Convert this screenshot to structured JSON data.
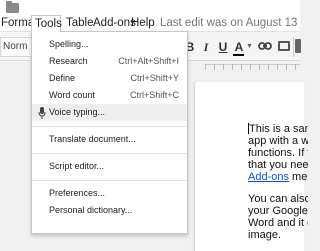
{
  "menubar": {
    "items": [
      "Format",
      "Tools",
      "Table",
      "Add-ons",
      "Help"
    ],
    "last_edit": "Last edit was on August 13"
  },
  "toolbar": {
    "style_value": "Norm",
    "bold_label": "B",
    "italic_label": "I",
    "underline_label": "U",
    "text_color_label": "A"
  },
  "tools_menu": {
    "items": [
      {
        "label": "Spelling...",
        "shortcut": ""
      },
      {
        "label": "Research",
        "shortcut": "Ctrl+Alt+Shift+I"
      },
      {
        "label": "Define",
        "shortcut": "Ctrl+Shift+Y"
      },
      {
        "label": "Word count",
        "shortcut": "Ctrl+Shift+C"
      },
      {
        "label": "Voice typing...",
        "shortcut": ""
      },
      {
        "label": "Translate document...",
        "shortcut": ""
      },
      {
        "label": "Script editor...",
        "shortcut": ""
      },
      {
        "label": "Preferences...",
        "shortcut": ""
      },
      {
        "label": "Personal dictionary...",
        "shortcut": ""
      }
    ]
  },
  "document": {
    "para1_lines": [
      "This is a samp",
      "app with a wic",
      "functions.  If th",
      "that you need,"
    ],
    "para1_link": "Add-ons",
    "para1_link_rest": " menu",
    "para2_lines": [
      "You can also c",
      "your Google D",
      "Word and it ca",
      "image."
    ]
  },
  "colors": {
    "link": "#1155cc",
    "hover": "#eeeeee"
  }
}
